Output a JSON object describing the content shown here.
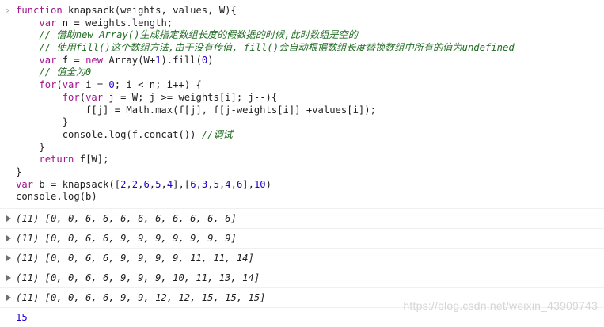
{
  "code_lines": [
    "function knapsack(weights, values, W){",
    "    var n = weights.length;",
    "    // 借助new Array()生成指定数组长度的假数据的时候,此时数组是空的",
    "    // 使用fill()这个数组方法,由于没有传值, fill()会自动根据数组长度替换数组中所有的值为undefined",
    "    var f = new Array(W+1).fill(0)",
    "    // 值全为0",
    "    for(var i = 0; i < n; i++) {",
    "        for(var j = W; j >= weights[i]; j--){",
    "            f[j] = Math.max(f[j], f[j-weights[i]] +values[i]);",
    "        }",
    "        console.log(f.concat()) //调试",
    "    }",
    "    return f[W];",
    "}",
    "var b = knapsack([2,2,6,5,4],[6,3,5,4,6],10)",
    "console.log(b)"
  ],
  "outputs": [
    "(11) [0, 0, 6, 6, 6, 6, 6, 6, 6, 6, 6]",
    "(11) [0, 0, 6, 6, 9, 9, 9, 9, 9, 9, 9]",
    "(11) [0, 0, 6, 6, 9, 9, 9, 9, 11, 11, 14]",
    "(11) [0, 0, 6, 6, 9, 9, 9, 10, 11, 13, 14]",
    "(11) [0, 0, 6, 6, 9, 9, 12, 12, 15, 15, 15]"
  ],
  "result": "15",
  "watermark": "https://blog.csdn.net/weixin_43909743",
  "colors": {
    "keyword": "#a3158f",
    "number": "#1c00cf",
    "comment": "#236e25",
    "text": "#1f1f1f"
  },
  "icons": {
    "prompt": "chevron-right-icon",
    "expand": "triangle-right-icon"
  }
}
